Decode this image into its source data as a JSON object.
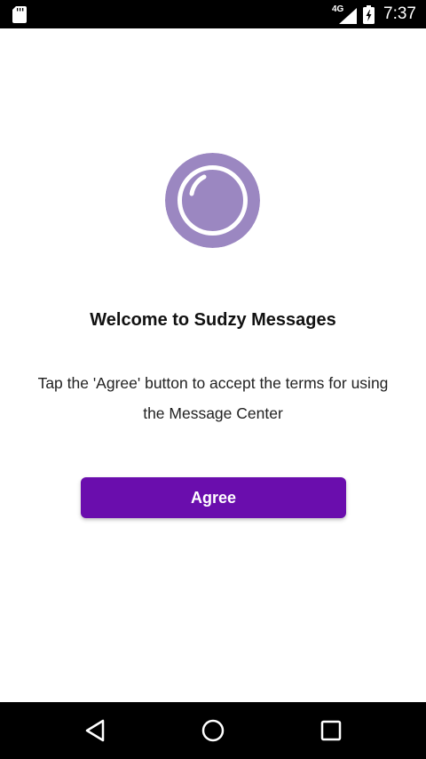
{
  "status_bar": {
    "network_type": "4G",
    "time": "7:37",
    "icons": [
      "sd-card-icon",
      "cell-signal-icon",
      "battery-charging-icon"
    ]
  },
  "logo": {
    "icon": "bubble-logo-icon",
    "color": "#9b87c1"
  },
  "welcome": {
    "title": "Welcome to Sudzy Messages",
    "body": "Tap the 'Agree' button to accept the terms for using the Message Center"
  },
  "agree_button": {
    "label": "Agree",
    "color": "#6a0dad"
  },
  "nav_bar": {
    "icons": [
      "back-icon",
      "home-icon",
      "recents-icon"
    ]
  }
}
